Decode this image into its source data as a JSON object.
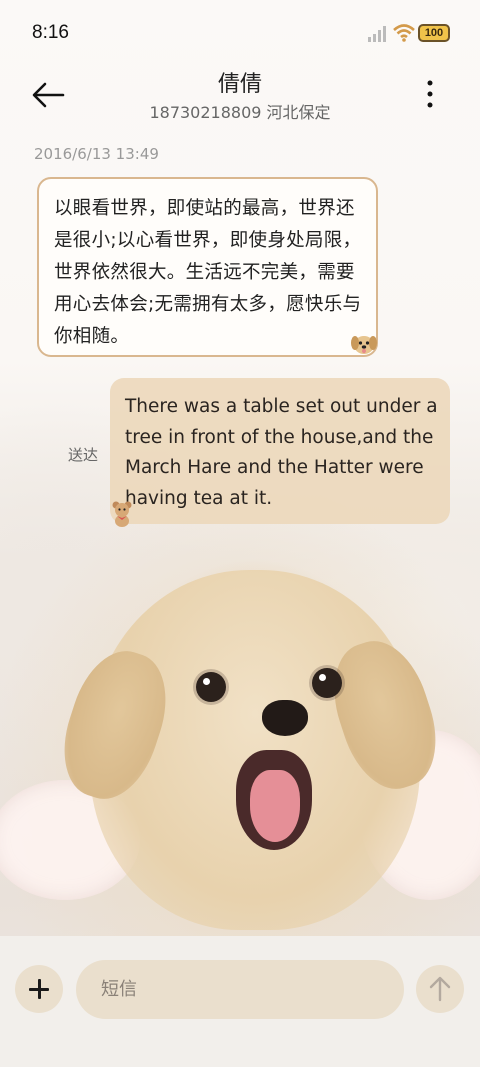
{
  "status_bar": {
    "time": "8:16",
    "battery": "100",
    "icons": [
      "signal-icon",
      "wifi-icon",
      "battery-icon"
    ]
  },
  "header": {
    "contact_name": "倩倩",
    "contact_detail": "18730218809 河北保定",
    "icons": [
      "back-arrow-icon",
      "more-vertical-icon"
    ]
  },
  "conversation": {
    "timestamp": "2016/6/13 13:49",
    "incoming_message": "以眼看世界，即使站的最高，世界还是很小;以心看世界，即使身处局限，世界依然很大。生活远不完美，需要用心去体会;无需拥有太多，愿快乐与你相随。",
    "outgoing_status": "送达",
    "outgoing_message": "There was a table set out under a tree in front of the house,and the March Hare and the Hatter were having tea at it."
  },
  "composer": {
    "placeholder": "短信",
    "icons": [
      "plus-icon",
      "send-arrow-icon"
    ]
  },
  "colors": {
    "incoming_border": "#d9b78f",
    "outgoing_bubble": "#ecd7b9",
    "composer_fill": "#eadfcd"
  }
}
